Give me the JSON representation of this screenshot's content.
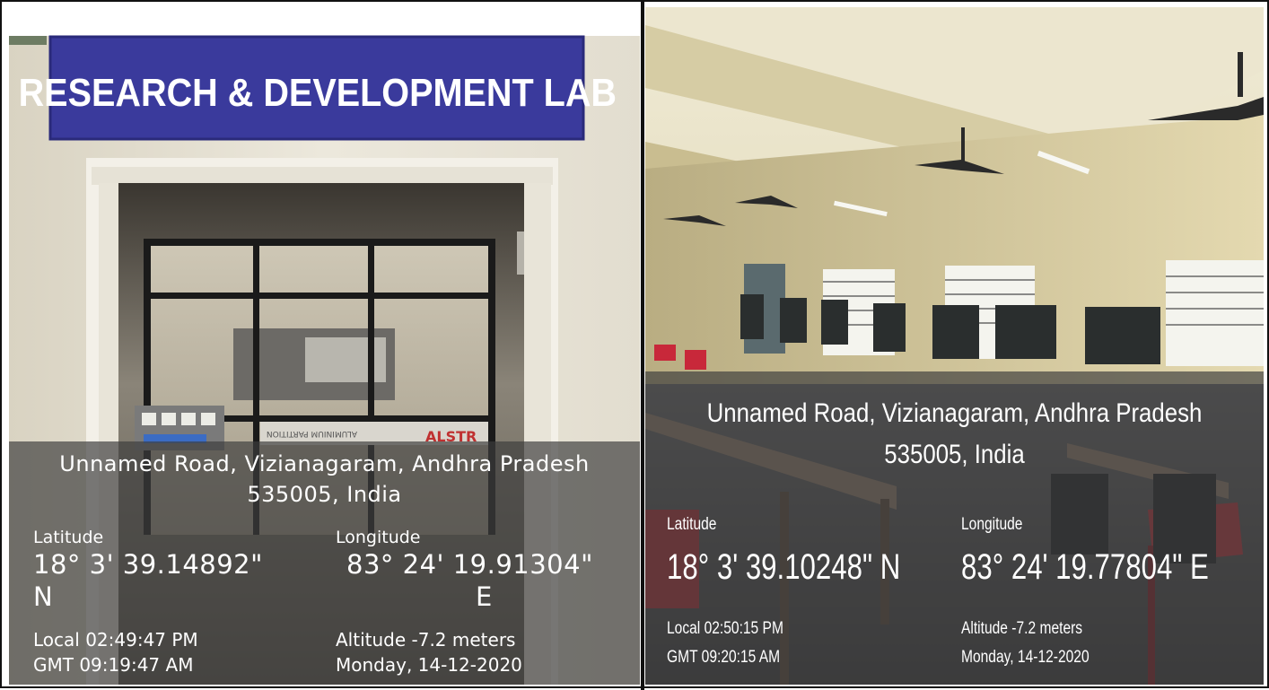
{
  "left": {
    "sign_text": "RESEARCH & DEVELOPMENT LAB",
    "address": "Unnamed Road, Vizianagaram, Andhra Pradesh 535005, India",
    "latitude_label": "Latitude",
    "latitude_value": "18° 3' 39.14892\"",
    "latitude_hemi": "N",
    "longitude_label": "Longitude",
    "longitude_value": "83° 24' 19.91304\"",
    "longitude_hemi": "E",
    "local_time": "Local 02:49:47 PM",
    "gmt_time": "GMT 09:19:47 AM",
    "altitude": "Altitude -7.2 meters",
    "date": "Monday, 14-12-2020",
    "door_label_1": "ALSTR",
    "door_label_2": "ALUMINIUM PARTITION"
  },
  "right": {
    "address_line1": "Unnamed Road, Vizianagaram, Andhra Pradesh",
    "address_line2": "535005, India",
    "latitude_label": "Latitude",
    "latitude_value": "18° 3' 39.10248\" N",
    "longitude_label": "Longitude",
    "longitude_value": "83° 24' 19.77804\" E",
    "local_time": "Local 02:50:15 PM",
    "gmt_time": "GMT 09:20:15 AM",
    "altitude": "Altitude -7.2 meters",
    "date": "Monday, 14-12-2020"
  },
  "colors": {
    "sign_blue": "#3a3a9c",
    "overlay": "#3c3c3c",
    "wall_left": "#e9e4d6",
    "wall_right": "#d8cba0",
    "ceiling_right": "#ece6cf"
  }
}
